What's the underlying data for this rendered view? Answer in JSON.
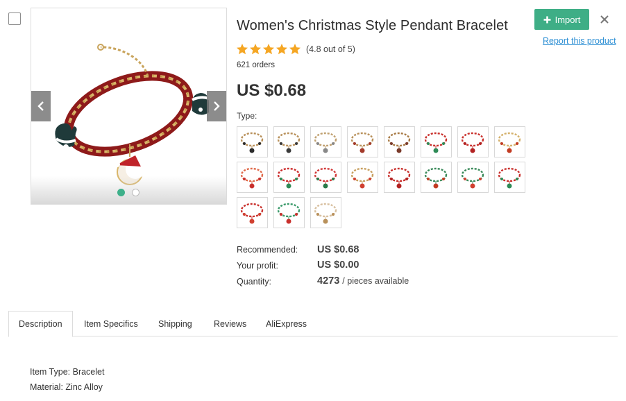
{
  "product": {
    "title": "Women's Christmas Style Pendant Bracelet",
    "rating_text": "(4.8 out of 5)",
    "rating_value": 4.8,
    "orders": "621 orders",
    "price": "US $0.68",
    "type_label": "Type:"
  },
  "gallery": {
    "image_count": 2,
    "active_index": 0
  },
  "variants": [
    {
      "chain": "#b8905a",
      "charm": "#2b2b2b"
    },
    {
      "chain": "#b8905a",
      "charm": "#3a3a3a"
    },
    {
      "chain": "#c0a070",
      "charm": "#888888"
    },
    {
      "chain": "#b8905a",
      "charm": "#a33a2a"
    },
    {
      "chain": "#a87a45",
      "charm": "#7a3a2a"
    },
    {
      "chain": "#c9302c",
      "charm": "#2e8b57"
    },
    {
      "chain": "#c9302c",
      "charm": "#b22222"
    },
    {
      "chain": "#d4b06a",
      "charm": "#c23b22"
    },
    {
      "chain": "#e06a4a",
      "charm": "#c9302c"
    },
    {
      "chain": "#cc2b2b",
      "charm": "#2e8b57"
    },
    {
      "chain": "#d23a3a",
      "charm": "#2a7a4a"
    },
    {
      "chain": "#c8a060",
      "charm": "#d04030"
    },
    {
      "chain": "#c9302c",
      "charm": "#b22222"
    },
    {
      "chain": "#3a8a5a",
      "charm": "#c23b22"
    },
    {
      "chain": "#3a8a5a",
      "charm": "#d04030"
    },
    {
      "chain": "#c9302c",
      "charm": "#2e8b57"
    },
    {
      "chain": "#c9302c",
      "charm": "#d04030"
    },
    {
      "chain": "#3a9a6a",
      "charm": "#c9302c"
    },
    {
      "chain": "#d8c0a0",
      "charm": "#b8905a"
    }
  ],
  "pricing": {
    "recommended_label": "Recommended:",
    "recommended_value": "US $0.68",
    "profit_label": "Your profit:",
    "profit_value": "US $0.00",
    "quantity_label": "Quantity:",
    "quantity_value": "4273",
    "quantity_unit": "/ pieces available"
  },
  "actions": {
    "import_label": "Import",
    "report_label": "Report this product"
  },
  "tabs": [
    {
      "label": "Description"
    },
    {
      "label": "Item Specifics"
    },
    {
      "label": "Shipping"
    },
    {
      "label": "Reviews"
    },
    {
      "label": "AliExpress"
    }
  ],
  "description": [
    "Item Type: Bracelet",
    "Material: Zinc Alloy"
  ],
  "colors": {
    "accent": "#3eae86",
    "star": "#f5a623",
    "link": "#2d8fd4"
  },
  "icons": {
    "import": "plus-icon",
    "close": "close-icon",
    "prev": "chevron-left-icon",
    "next": "chevron-right-icon",
    "star": "star-icon"
  }
}
